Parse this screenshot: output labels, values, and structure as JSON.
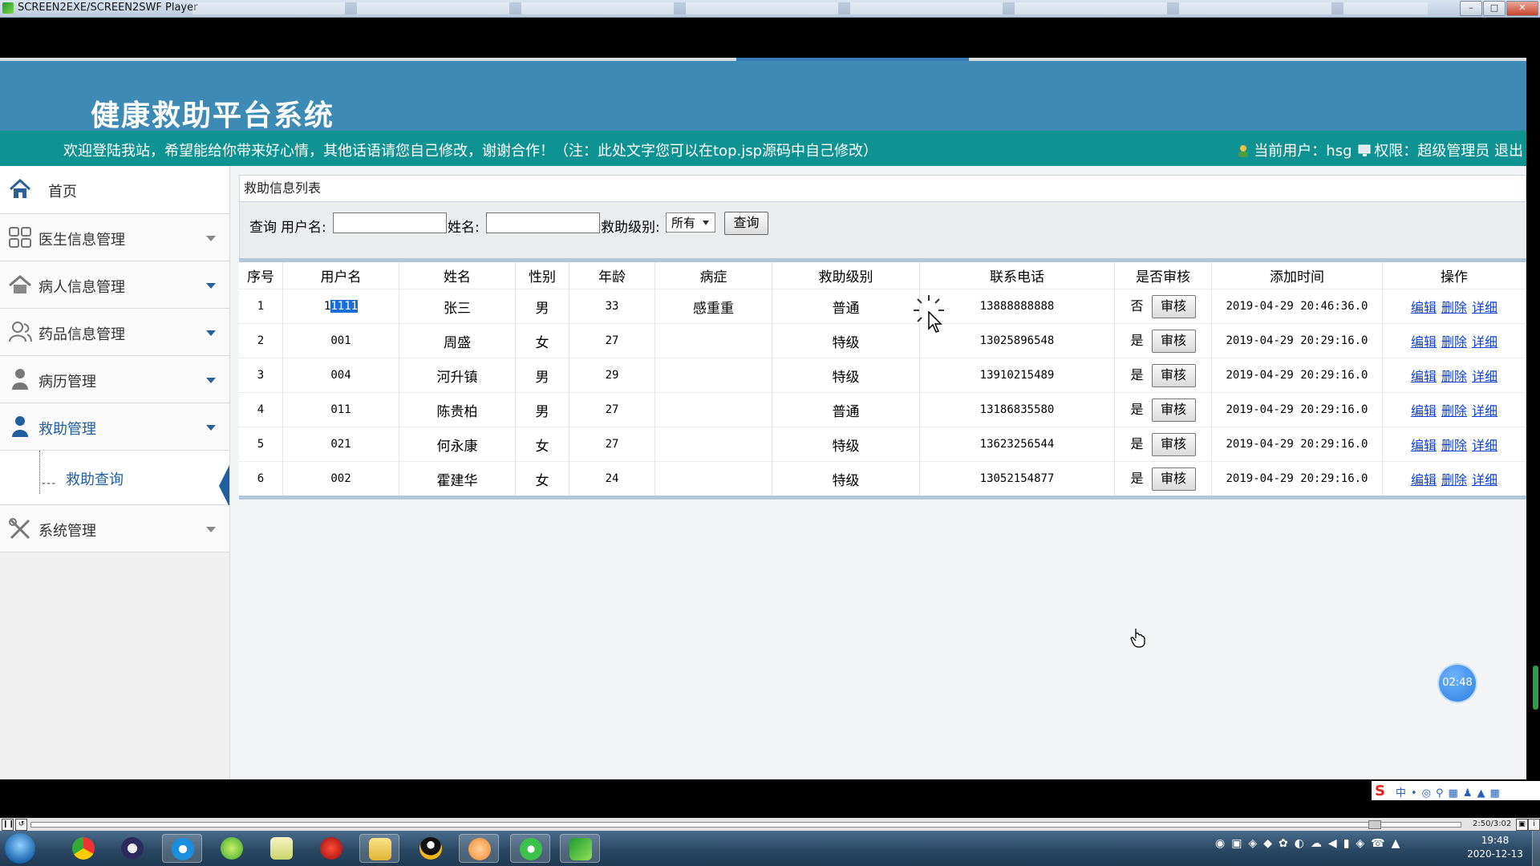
{
  "window": {
    "title": "SCREEN2EXE/SCREEN2SWF Player"
  },
  "header": {
    "logo": "健康救助平台系统"
  },
  "welcome": {
    "message": "欢迎登陆我站，希望能给你带来好心情，其他话语请您自己修改，谢谢合作！（注：此处文字您可以在top.jsp源码中自己修改）",
    "current_user_label": "当前用户：hsg",
    "permission_label": "权限：超级管理员",
    "logout": "退出"
  },
  "sidebar": {
    "items": [
      {
        "label": "首页",
        "icon": "home-icon"
      },
      {
        "label": "医生信息管理",
        "icon": "grid-icon"
      },
      {
        "label": "病人信息管理",
        "icon": "house-icon"
      },
      {
        "label": "药品信息管理",
        "icon": "users-icon"
      },
      {
        "label": "病历管理",
        "icon": "user-icon"
      },
      {
        "label": "救助管理",
        "icon": "user-icon"
      },
      {
        "label": "系统管理",
        "icon": "tools-icon"
      }
    ],
    "sub_item": {
      "tree_prefix": "---",
      "label": "救助查询"
    }
  },
  "main": {
    "panel_title": "救助信息列表",
    "search": {
      "query_label": "查询",
      "username_label": "用户名:",
      "username_value": "",
      "name_label": "姓名:",
      "name_value": "",
      "level_label": "救助级别:",
      "level_selected": "所有",
      "query_button": "查询"
    },
    "table": {
      "headers": [
        "序号",
        "用户名",
        "姓名",
        "性别",
        "年龄",
        "病症",
        "救助级别",
        "联系电话",
        "是否审核",
        "添加时间",
        "操作"
      ],
      "rows": [
        {
          "no": "1",
          "username_prefix": "1",
          "username_selected": "1111",
          "name": "张三",
          "gender": "男",
          "age": "33",
          "disease": "感重重",
          "level": "普通",
          "phone": "13888888888",
          "audited": "否",
          "time": "2019-04-29 20:46:36.0"
        },
        {
          "no": "2",
          "username_prefix": "001",
          "username_selected": "",
          "name": "周盛",
          "gender": "女",
          "age": "27",
          "disease": "",
          "level": "特级",
          "phone": "13025896548",
          "audited": "是",
          "time": "2019-04-29 20:29:16.0"
        },
        {
          "no": "3",
          "username_prefix": "004",
          "username_selected": "",
          "name": "河升镇",
          "gender": "男",
          "age": "29",
          "disease": "",
          "level": "特级",
          "phone": "13910215489",
          "audited": "是",
          "time": "2019-04-29 20:29:16.0"
        },
        {
          "no": "4",
          "username_prefix": "011",
          "username_selected": "",
          "name": "陈贵柏",
          "gender": "男",
          "age": "27",
          "disease": "",
          "level": "普通",
          "phone": "13186835580",
          "audited": "是",
          "time": "2019-04-29 20:29:16.0"
        },
        {
          "no": "5",
          "username_prefix": "021",
          "username_selected": "",
          "name": "何永康",
          "gender": "女",
          "age": "27",
          "disease": "",
          "level": "特级",
          "phone": "13623256544",
          "audited": "是",
          "time": "2019-04-29 20:29:16.0"
        },
        {
          "no": "6",
          "username_prefix": "002",
          "username_selected": "",
          "name": "霍建华",
          "gender": "女",
          "age": "24",
          "disease": "",
          "level": "特级",
          "phone": "13052154877",
          "audited": "是",
          "time": "2019-04-29 20:29:16.0"
        }
      ],
      "audit_button": "审核",
      "actions": {
        "edit": "编辑",
        "delete": "删除",
        "detail": "详细"
      }
    }
  },
  "overlay": {
    "timer": "02:48"
  },
  "player": {
    "elapsed": "2:50/3:02",
    "progress_fraction": 0.94
  },
  "ime": {
    "logo": "S",
    "mode": "中"
  },
  "taskbar": {
    "time": "19:48",
    "date": "2020-12-13"
  },
  "colors": {
    "header_bg": "#3d8ab5",
    "welcome_bg": "#0e9292",
    "nav_accent": "#1f5fa0",
    "link": "#0b3fd6"
  }
}
